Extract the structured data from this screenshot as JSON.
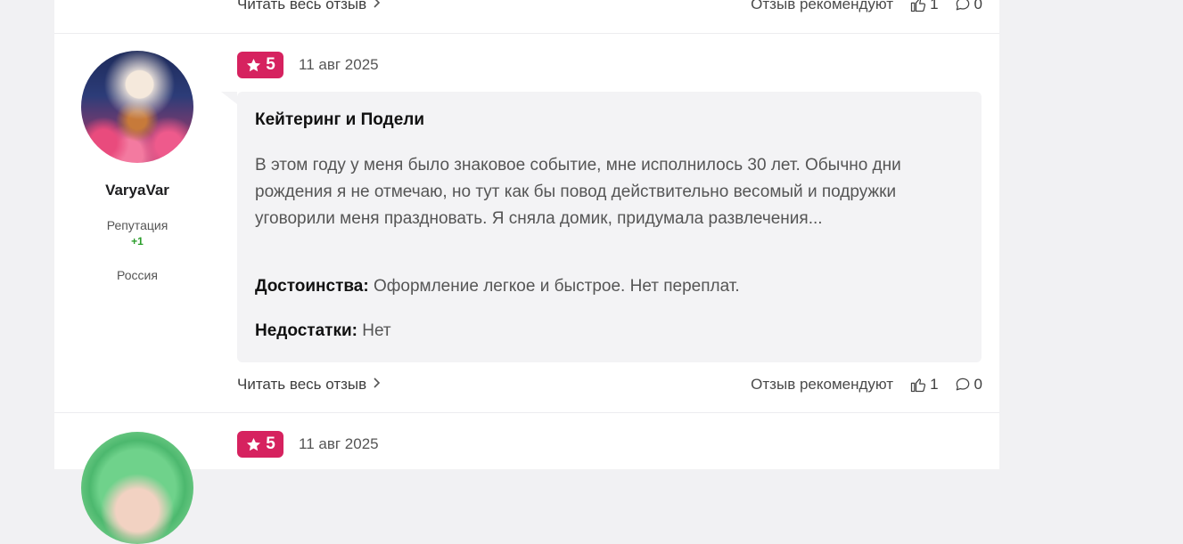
{
  "colors": {
    "rating_badge": "#d6225f",
    "reputation_positive": "#2a9d2a"
  },
  "previous_review": {
    "read_more": "Читать весь отзыв",
    "recommend_label": "Отзыв рекомендуют",
    "likes": "1",
    "comments": "0"
  },
  "review": {
    "author": {
      "name": "VaryaVar",
      "reputation_label": "Репутация",
      "reputation_value": "+1",
      "country": "Россия"
    },
    "rating": "5",
    "date": "11 авг 2025",
    "title": "Кейтеринг и Подели",
    "text": "В этом году у меня было знаковое событие, мне исполнилось 30 лет. Обычно дни рождения я не отмечаю, но тут как бы повод действительно весомый и подружки уговорили меня праздновать. Я сняла домик, придумала развлечения...",
    "pros_label": "Достоинства:",
    "pros": "Оформление легкое и быстрое. Нет переплат.",
    "cons_label": "Недостатки:",
    "cons": "Нет",
    "read_more": "Читать весь отзыв",
    "recommend_label": "Отзыв рекомендуют",
    "likes": "1",
    "comments": "0"
  },
  "next_review": {
    "rating": "5",
    "date": "11 авг 2025"
  },
  "icons": {
    "chevron": "chevron-right-icon",
    "like": "thumb-up-icon",
    "comment": "comment-icon",
    "star": "star-icon"
  }
}
